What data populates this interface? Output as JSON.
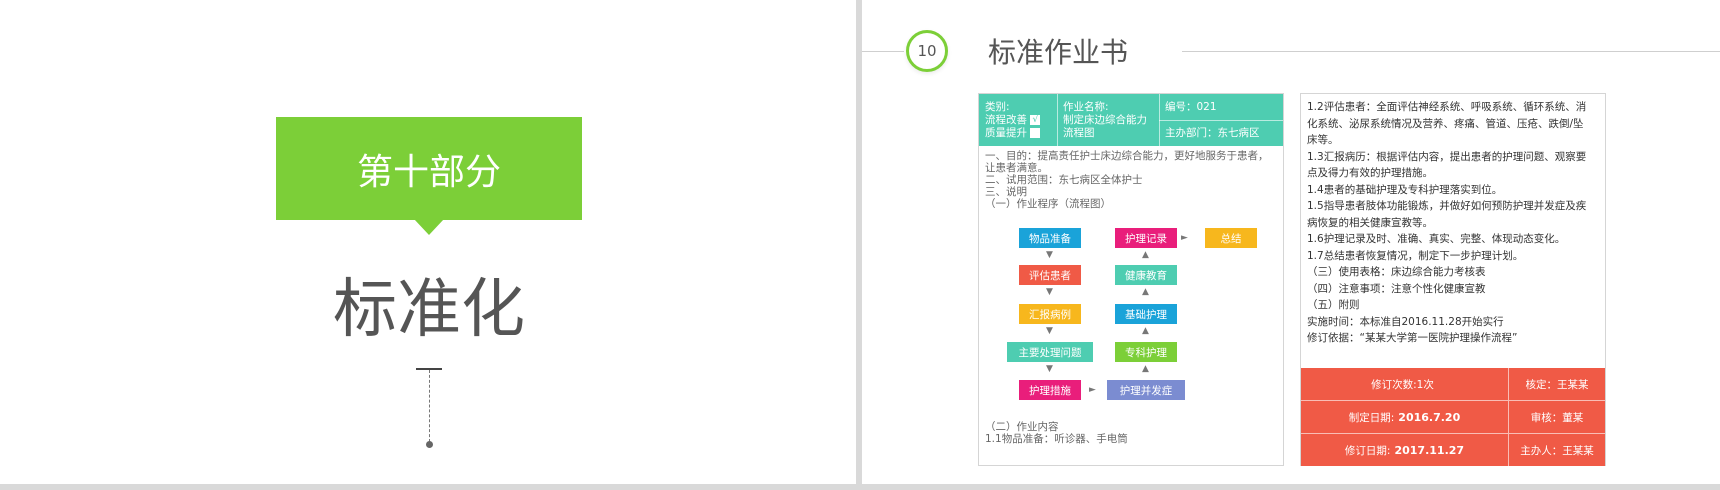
{
  "left_slide": {
    "section_label": "第十部分",
    "big_title": "标准化"
  },
  "right_slide": {
    "number": "10",
    "title": "标准作业书",
    "doc": {
      "category_label": "类别:",
      "category_opt1": "流程改善",
      "category_opt2": "质量提升",
      "check_mark": "√",
      "task_label": "作业名称:",
      "task_line1": "制定床边综合能力",
      "task_line2": "流程图",
      "code": "编号：021",
      "department": "主办部门：东七病区",
      "lines": [
        "一、目的：提高责任护士床边综合能力，更好地服务于患者，",
        "让患者满意。",
        "二、试用范围：东七病区全体护士",
        "三、说明",
        "（一）作业程序（流程图）"
      ],
      "flow": {
        "left": [
          "物品准备",
          "评估患者",
          "汇报病例",
          "主要处理问题",
          "护理措施"
        ],
        "right": [
          "护理记录",
          "健康教育",
          "基础护理",
          "专科护理",
          "护理并发症"
        ],
        "end": "总结"
      },
      "footer_lines": [
        "（二）作业内容",
        "1.1物品准备：听诊器、手电筒"
      ]
    },
    "panel": {
      "lines": [
        "1.2评估患者：全面评估神经系统、呼吸系统、循环系统、消",
        "化系统、泌尿系统情况及营养、疼痛、管道、压疮、跌倒/坠",
        "床等。",
        "1.3汇报病历：根据评估内容，提出患者的护理问题、观察要",
        "点及得力有效的护理措施。",
        "1.4患者的基础护理及专科护理落实到位。",
        "1.5指导患者肢体功能锻炼，并做好如何预防护理并发症及疾",
        "病恢复的相关健康宣教等。",
        "1.6护理记录及时、准确、真实、完整、体现动态变化。",
        "1.7总结患者恢复情况，制定下一步护理计划。",
        "（三）使用表格：床边综合能力考核表",
        "（四）注意事项：注意个性化健康宣教",
        "（五）附则",
        "实施时间：本标准自2016.11.28开始实行",
        "修订依据：“某某大学第一医院护理操作流程”"
      ],
      "revision": {
        "rows": [
          {
            "label": "修订次数:1次",
            "value": "",
            "right": "核定：王某某"
          },
          {
            "label": "制定日期:",
            "value": "2016.7.20",
            "right": "审核：董某"
          },
          {
            "label": "修订日期:",
            "value": "2017.11.27",
            "right": "主办人：王某某"
          }
        ]
      }
    }
  },
  "colors": {
    "green": "#7ccf38",
    "teal": "#4ecdb1",
    "red": "#f05a46",
    "flow_blue": "#1aa3d9",
    "flow_orange": "#f05a46",
    "flow_yellow": "#f7b71d",
    "flow_teal": "#4ecdb1",
    "flow_magenta": "#e91e7b",
    "flow_green": "#7ccf38",
    "flow_purple": "#7b8cd1"
  }
}
